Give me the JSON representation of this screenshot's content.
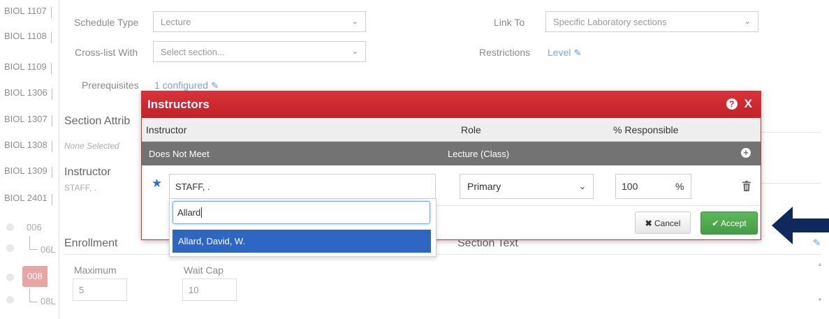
{
  "courses": [
    "BIOL 1107",
    "BIOL 1108",
    "BIOL 1109",
    "BIOL 1306",
    "BIOL 1307",
    "BIOL 1308",
    "BIOL 1309",
    "BIOL 2401"
  ],
  "sections": {
    "s006": "006",
    "s06l": "06L",
    "s008": "008",
    "s08l": "08L"
  },
  "form": {
    "schedule_type_label": "Schedule Type",
    "schedule_type_value": "Lecture",
    "link_to_label": "Link To",
    "link_to_value": "Specific Laboratory sections",
    "crosslist_label": "Cross-list With",
    "crosslist_placeholder": "Select section...",
    "restrictions_label": "Restrictions",
    "restrictions_value": "Level",
    "prereq_label": "Prerequisites",
    "prereq_value": "1 configured"
  },
  "page": {
    "section_attrib": "Section Attrib",
    "none_selected": "None Selected",
    "instructor_head": "Instructor",
    "instructor_value": "STAFF, .",
    "enrollment_head": "Enrollment",
    "section_text_head": "Section Text",
    "maximum_label": "Maximum",
    "maximum_value": "5",
    "waitcap_label": "Wait Cap",
    "waitcap_value": "10"
  },
  "modal": {
    "title": "Instructors",
    "help": "?",
    "close": "X",
    "col_instructor": "Instructor",
    "col_role": "Role",
    "col_responsible": "% Responsible",
    "meeting": "Does Not Meet",
    "meeting_type": "Lecture (Class)",
    "instructor_selected": "STAFF, .",
    "search_value": "Allard",
    "option": "Allard, David, W.",
    "role_value": "Primary",
    "pct_value": "100",
    "pct_sign": "%",
    "cancel_label": "Cancel",
    "accept_label": "Accept"
  },
  "colors": {
    "brand_red": "#c22228",
    "accept_green": "#4cae4c",
    "highlight_blue": "#2e67c3",
    "arrow_navy": "#0e2a5c"
  }
}
